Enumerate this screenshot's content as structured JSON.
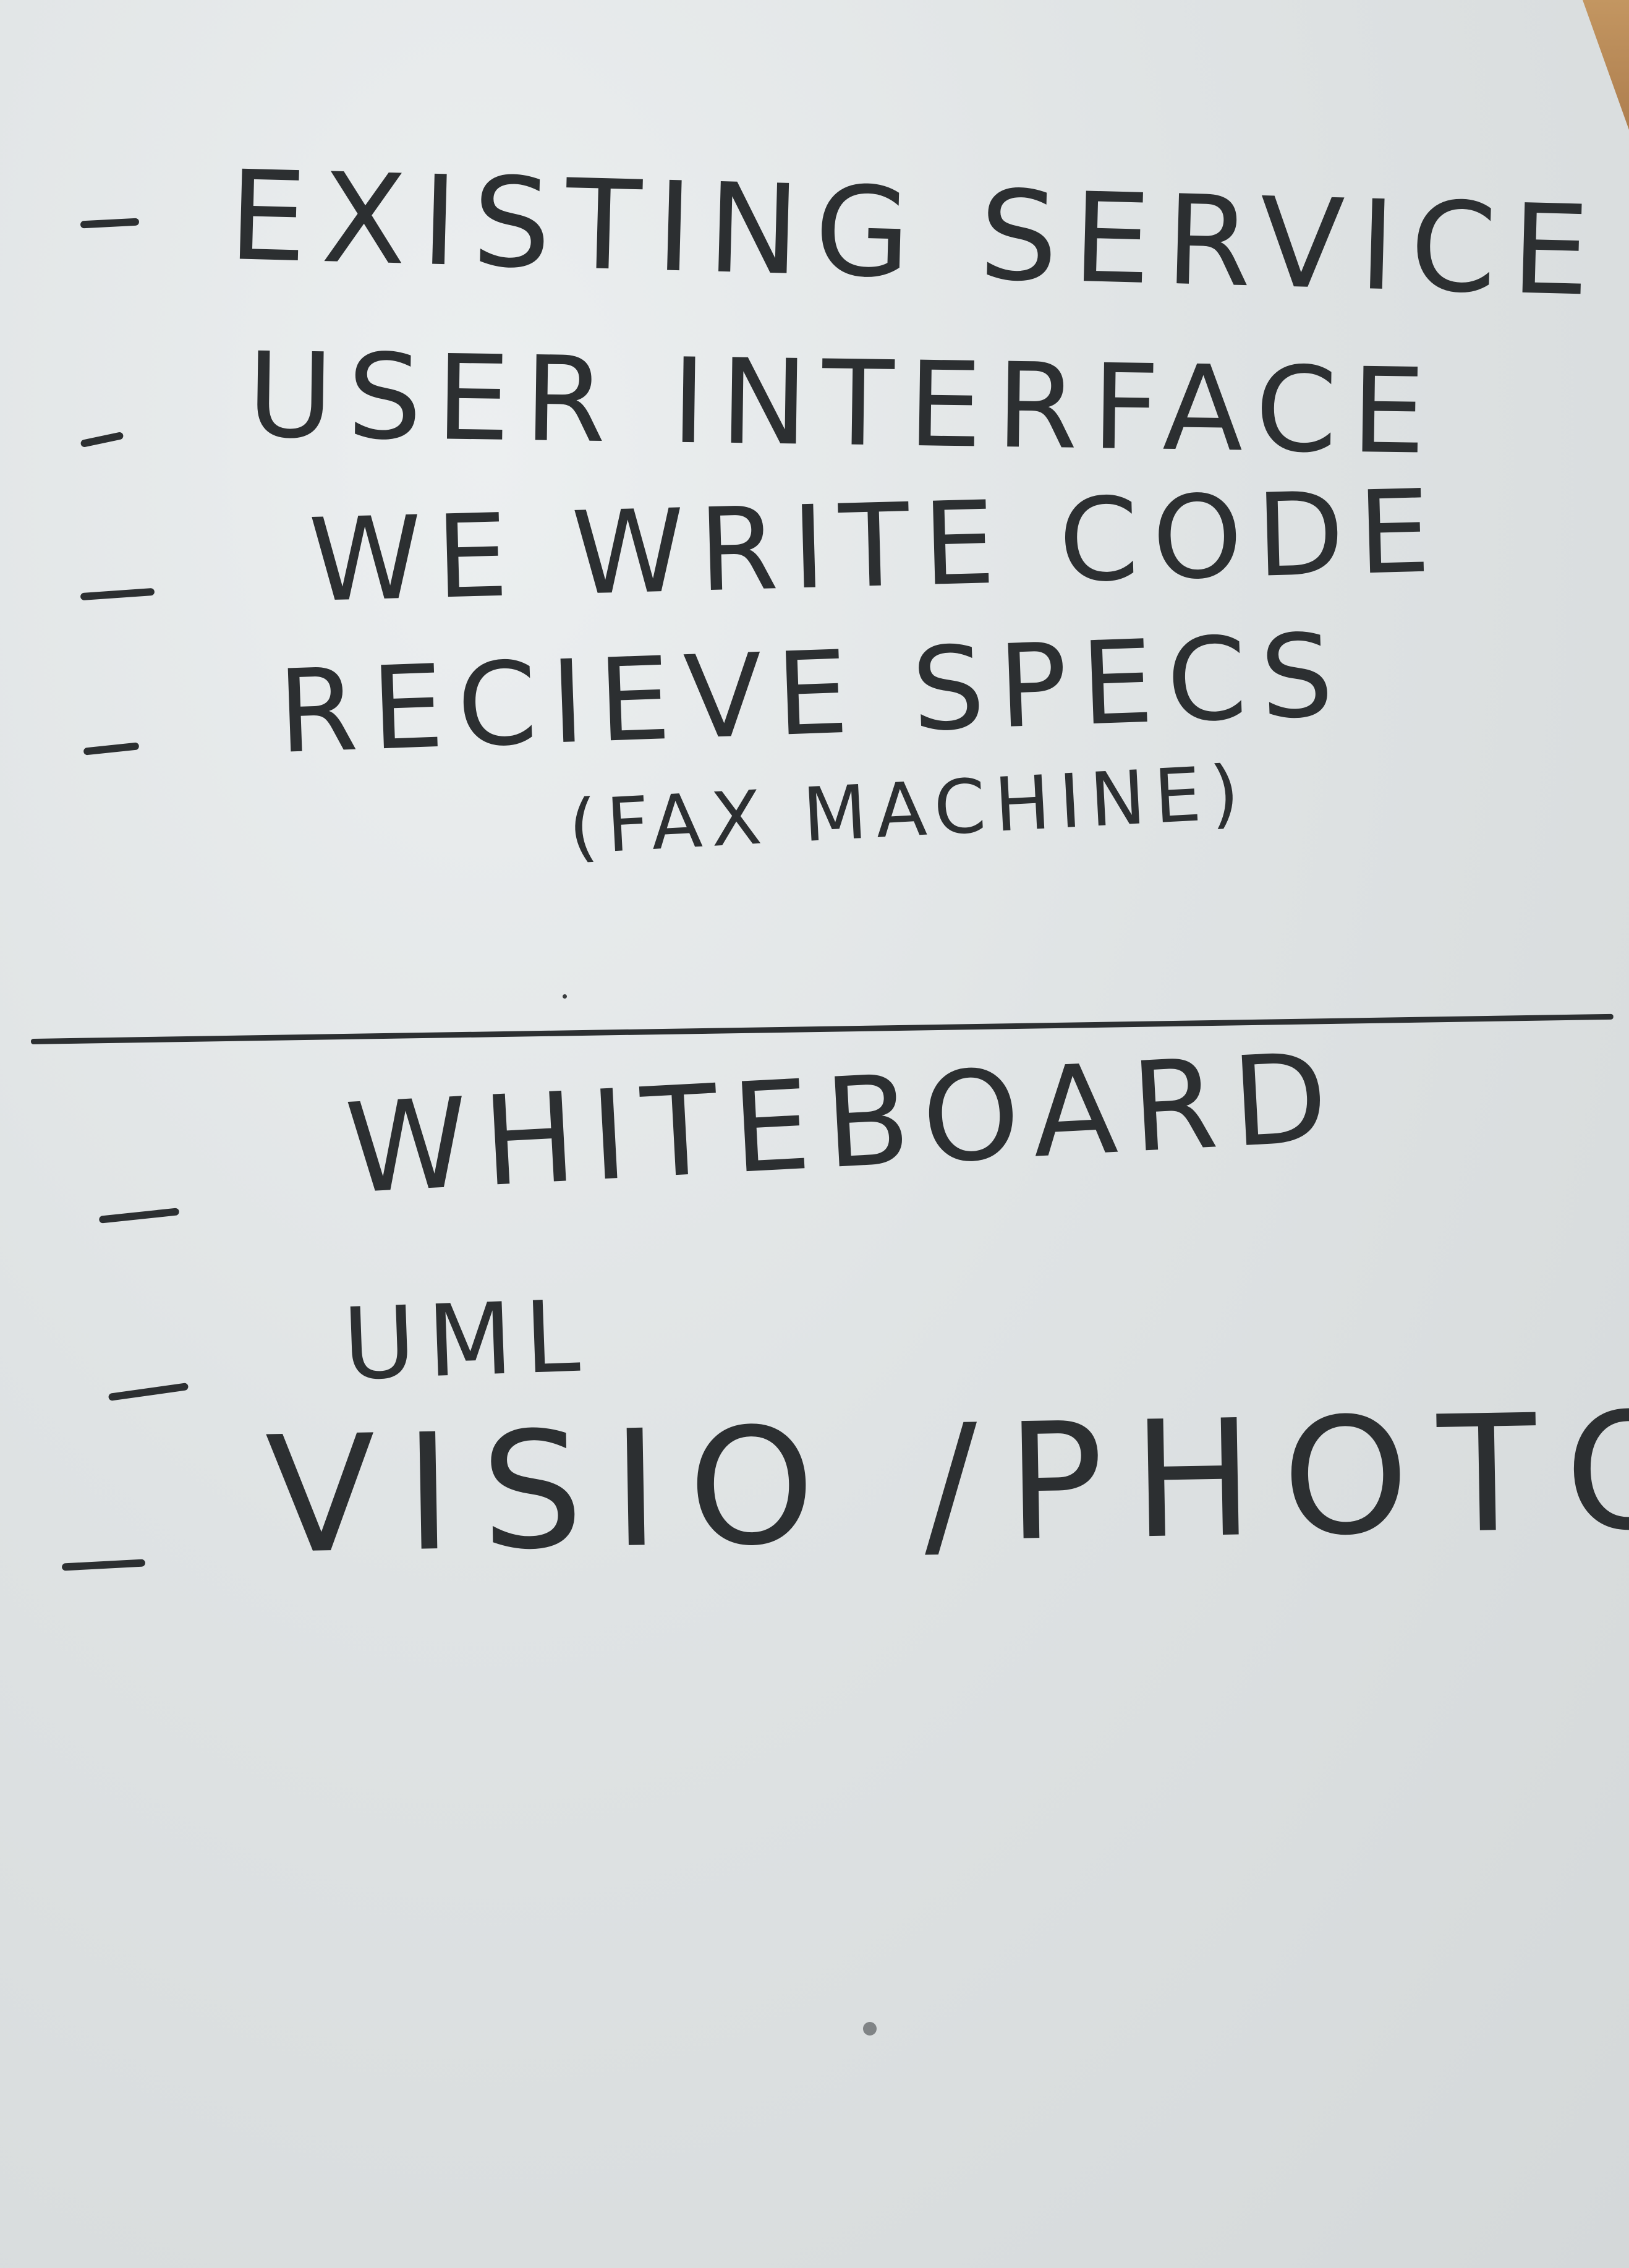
{
  "notes": {
    "group_1": [
      "EXISTING SERVICE",
      "USER INTERFACE",
      "WE WRITE CODE",
      "RECIEVE SPECS"
    ],
    "group_1_sub": "(FAX MACHINE)",
    "group_2": [
      "WHITEBOARD",
      "UML",
      "VISIO /PHOTO"
    ]
  },
  "ink_color": "#2c2f31",
  "paper_color": "#e3e7e8"
}
